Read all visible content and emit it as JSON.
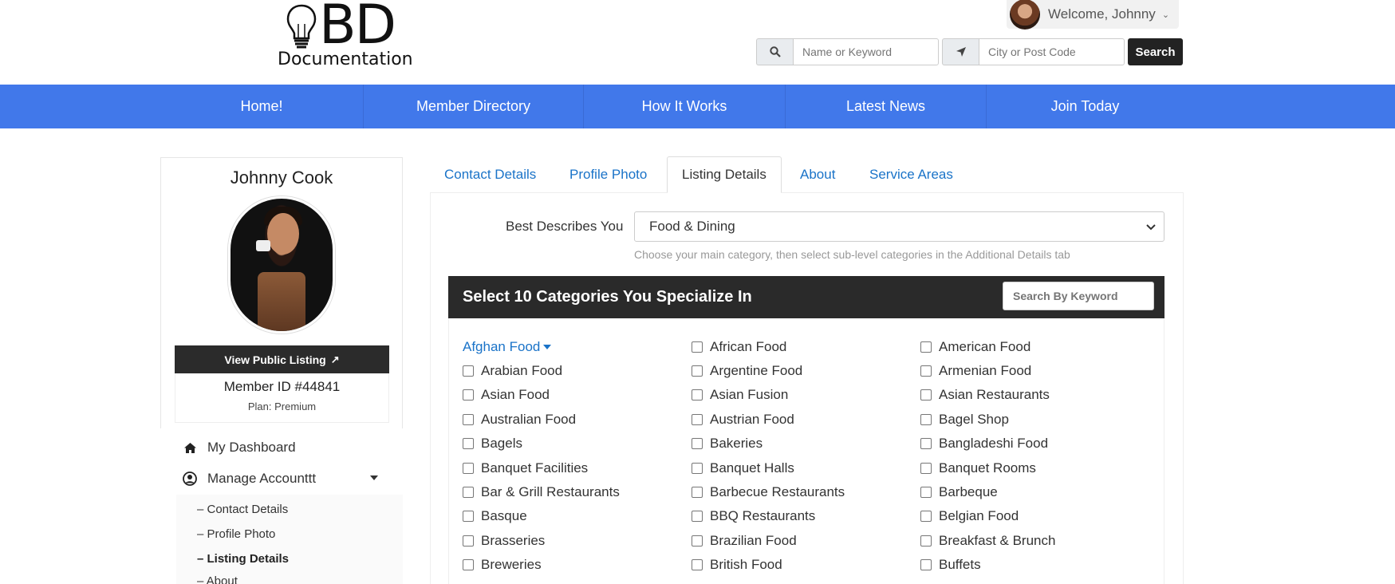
{
  "header": {
    "logo_mark": "BD",
    "logo_sub": "Documentation",
    "welcome": "Welcome, Johnny",
    "search": {
      "keyword_placeholder": "Name or Keyword",
      "location_placeholder": "City or Post Code",
      "button": "Search"
    }
  },
  "nav": {
    "items": [
      "Home!",
      "Member Directory",
      "How It Works",
      "Latest News",
      "Join Today"
    ]
  },
  "sidebar": {
    "name": "Johnny Cook",
    "view_public": "View Public Listing",
    "member_id": "Member ID #44841",
    "plan": "Plan: Premium",
    "links": [
      "My Dashboard",
      "Manage Accounttt"
    ],
    "submenu": [
      "– Contact Details",
      "– Profile Photo",
      "– Listing Details",
      "– About"
    ]
  },
  "tabs": [
    "Contact Details",
    "Profile Photo",
    "Listing Details",
    "About",
    "Service Areas"
  ],
  "form": {
    "label": "Best Describes You",
    "selected": "Food & Dining",
    "help": "Choose your main category, then select sub-level categories in the Additional Details tab"
  },
  "categories": {
    "title": "Select 10 Categories You Specialize In",
    "search_placeholder": "Search By Keyword",
    "expanded": "Afghan Food",
    "col1": [
      "Arabian Food",
      "Asian Food",
      "Australian Food",
      "Bagels",
      "Banquet Facilities",
      "Bar & Grill Restaurants",
      "Basque",
      "Brasseries",
      "Breweries"
    ],
    "col2": [
      "African Food",
      "Argentine Food",
      "Asian Fusion",
      "Austrian Food",
      "Bakeries",
      "Banquet Halls",
      "Barbecue Restaurants",
      "BBQ Restaurants",
      "Brazilian Food",
      "British Food"
    ],
    "col3": [
      "American Food",
      "Armenian Food",
      "Asian Restaurants",
      "Bagel Shop",
      "Bangladeshi Food",
      "Banquet Rooms",
      "Barbeque",
      "Belgian Food",
      "Breakfast & Brunch",
      "Buffets"
    ]
  },
  "colors": {
    "nav_bg": "#4178ea",
    "link": "#1a73c8",
    "dark": "#2a2a2a"
  }
}
